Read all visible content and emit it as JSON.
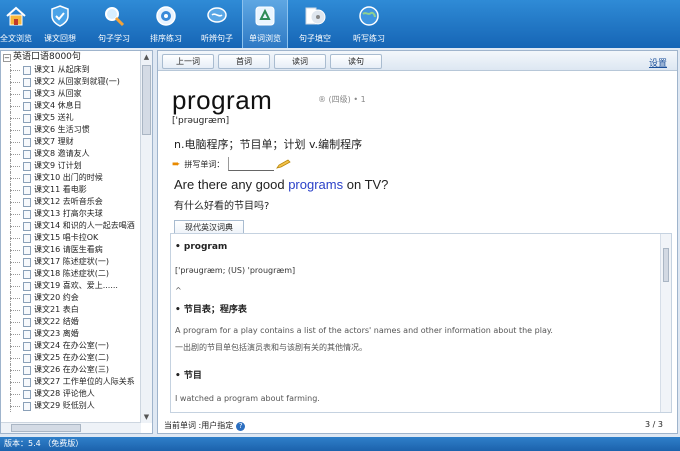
{
  "toolbar": {
    "buttons": [
      {
        "label": "全文浏览",
        "icon": "home-icon"
      },
      {
        "label": "课文回想",
        "icon": "shield-icon"
      },
      {
        "label": "句子学习",
        "icon": "magnifier-icon"
      },
      {
        "label": "排序练习",
        "icon": "target-icon"
      },
      {
        "label": "听辨句子",
        "icon": "speech-bubble-icon"
      },
      {
        "label": "单词浏览",
        "icon": "recycle-icon"
      },
      {
        "label": "句子填空",
        "icon": "cd-icon"
      },
      {
        "label": "听写练习",
        "icon": "globe-icon"
      }
    ],
    "active_index": 5
  },
  "tree": {
    "root": "英语口语8000句",
    "items": [
      "课文1 从起床到",
      "课文2 从回家到就寝(一)",
      "课文3 从回家",
      "课文4 休息日",
      "课文5 送礼",
      "课文6 生活习惯",
      "课文7 理财",
      "课文8 邀请友人",
      "课文9 订计划",
      "课文10 出门的时候",
      "课文11 看电影",
      "课文12 去听音乐会",
      "课文13 打高尔夫球",
      "课文14 和识的人一起去喝酒",
      "课文15 唱卡拉OK",
      "课文16 请医生看病",
      "课文17 陈述症状(一)",
      "课文18 陈述症状(二)",
      "课文19 喜欢、爱上......",
      "课文20 约会",
      "课文21 表白",
      "课文22 结婚",
      "课文23 离婚",
      "课文24 在办公室(一)",
      "课文25 在办公室(二)",
      "课文26 在办公室(三)",
      "课文27 工作单位的人际关系",
      "课文28 评论他人",
      "课文29 贬低别人"
    ]
  },
  "nav": {
    "buttons": [
      "上一词",
      "首词",
      "读词",
      "读句"
    ],
    "settings": "设置"
  },
  "word": {
    "text": "program",
    "meta": "® (四级) • 1",
    "phonetic": "['prəugræm]",
    "meaning": "n.电脑程序；节目单；计划 v.编制程序",
    "spell_label": "拼写单词："
  },
  "sentence": {
    "en_before": "Are there any good ",
    "en_highlight": "programs",
    "en_after": " on TV?",
    "cn": "有什么好看的节目吗?"
  },
  "dict": {
    "tab": "现代英汉词典",
    "headword": "• program",
    "pron": "['prəugræm; (US) 'prougræm]",
    "caret": "^",
    "sense1": "• 节目表；程序表",
    "sense1_en": "A program for a play contains a list of the actors' names and other information about the play.",
    "sense1_cn": "一出剧的节目单包括演员表和与该剧有关的其他情况。",
    "sense2": "• 节目",
    "sense2_en": "I watched a program about farming."
  },
  "status": {
    "current": "当前单词 :用户指定",
    "page": "3 / 3"
  },
  "footer": "版本：5.4    （免费版）",
  "colors": {
    "toolbar": "#1f74c4",
    "highlight": "#2a40c8"
  }
}
